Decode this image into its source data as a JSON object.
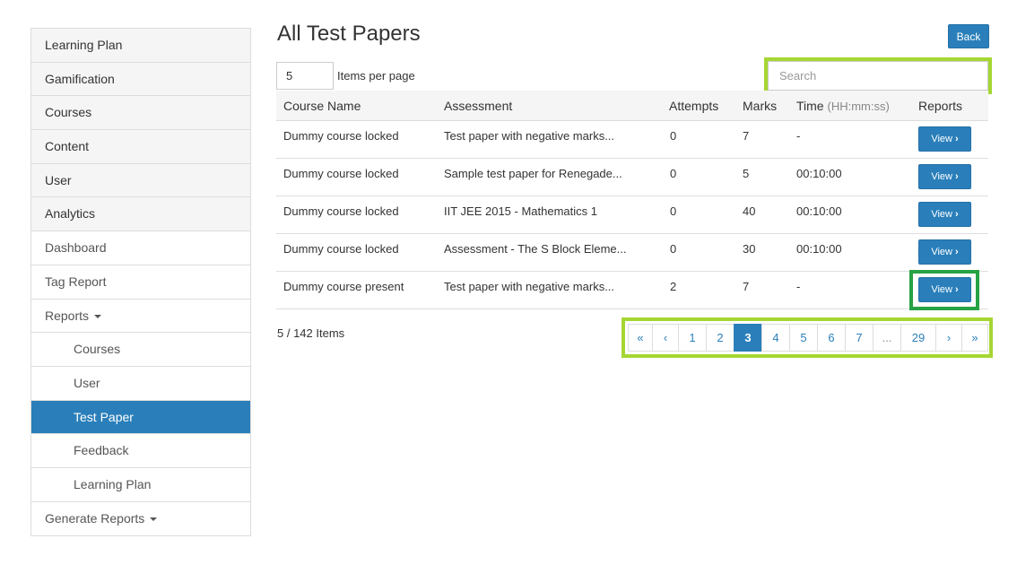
{
  "sidebar": {
    "items": [
      {
        "label": "Learning Plan"
      },
      {
        "label": "Gamification"
      },
      {
        "label": "Courses"
      },
      {
        "label": "Content"
      },
      {
        "label": "User"
      },
      {
        "label": "Analytics"
      },
      {
        "label": "Dashboard"
      },
      {
        "label": "Tag Report"
      },
      {
        "label": "Reports"
      },
      {
        "label": "Courses"
      },
      {
        "label": "User"
      },
      {
        "label": "Test Paper"
      },
      {
        "label": "Feedback"
      },
      {
        "label": "Learning Plan"
      },
      {
        "label": "Generate Reports"
      }
    ]
  },
  "header": {
    "title": "All Test Papers",
    "back_label": "Back"
  },
  "controls": {
    "per_page_value": "5",
    "per_page_label": "Items per page",
    "search_placeholder": "Search"
  },
  "table": {
    "columns": {
      "course_name": "Course Name",
      "assessment": "Assessment",
      "attempts": "Attempts",
      "marks": "Marks",
      "time": "Time",
      "time_unit": "(HH:mm:ss)",
      "reports": "Reports"
    },
    "rows": [
      {
        "course": "Dummy course locked",
        "assessment": "Test paper with negative marks...",
        "attempts": "0",
        "marks": "7",
        "time": "-",
        "action": "View"
      },
      {
        "course": "Dummy course locked",
        "assessment": "Sample test paper for Renegade...",
        "attempts": "0",
        "marks": "5",
        "time": "00:10:00",
        "action": "View"
      },
      {
        "course": "Dummy course locked",
        "assessment": "IIT JEE 2015 - Mathematics 1",
        "attempts": "0",
        "marks": "40",
        "time": "00:10:00",
        "action": "View"
      },
      {
        "course": "Dummy course locked",
        "assessment": "Assessment - The S Block Eleme...",
        "attempts": "0",
        "marks": "30",
        "time": "00:10:00",
        "action": "View"
      },
      {
        "course": "Dummy course present",
        "assessment": "Test paper with negative marks...",
        "attempts": "2",
        "marks": "7",
        "time": "-",
        "action": "View"
      }
    ]
  },
  "footer": {
    "items_count": "5 / 142 Items"
  },
  "pagination": {
    "first": "«",
    "prev": "‹",
    "pages": [
      "1",
      "2",
      "3",
      "4",
      "5",
      "6",
      "7"
    ],
    "current": "3",
    "ellipsis": "...",
    "last_page": "29",
    "next": "›",
    "last": "»"
  },
  "colors": {
    "primary": "#2a7fba",
    "highlight_lime": "#a6d633",
    "highlight_green": "#27a244"
  },
  "icons": {
    "dropdown": "caret-down-icon",
    "view_arrow": "chevron-right-icon"
  }
}
